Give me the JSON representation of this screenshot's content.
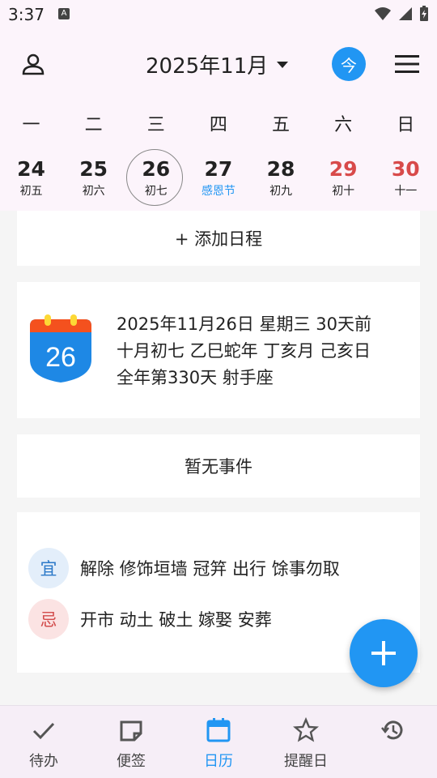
{
  "status": {
    "time": "3:37",
    "notification_badge": "A"
  },
  "header": {
    "title": "2025年11月",
    "today_label": "今"
  },
  "weekdays": [
    "一",
    "二",
    "三",
    "四",
    "五",
    "六",
    "日"
  ],
  "dates": [
    {
      "day": "24",
      "lunar": "初五"
    },
    {
      "day": "25",
      "lunar": "初六"
    },
    {
      "day": "26",
      "lunar": "初七"
    },
    {
      "day": "27",
      "lunar": "感恩节"
    },
    {
      "day": "28",
      "lunar": "初九"
    },
    {
      "day": "29",
      "lunar": "初十"
    },
    {
      "day": "30",
      "lunar": "十一"
    }
  ],
  "add_schedule_label": "+ 添加日程",
  "date_info": {
    "icon_day": "26",
    "line1": "2025年11月26日 星期三 30天前",
    "line2": "十月初七 乙巳蛇年 丁亥月 己亥日",
    "line3": "全年第330天 射手座"
  },
  "no_event_label": "暂无事件",
  "yiji": {
    "yi_label": "宜",
    "yi_text": "解除 修饰垣墙 冠笄 出行 馀事勿取",
    "ji_label": "忌",
    "ji_text": "开市 动土 破土 嫁娶 安葬"
  },
  "nav": [
    {
      "label": "待办",
      "icon": "check-icon"
    },
    {
      "label": "便签",
      "icon": "note-icon"
    },
    {
      "label": "日历",
      "icon": "calendar-icon"
    },
    {
      "label": "提醒日",
      "icon": "star-icon"
    },
    {
      "label": "",
      "icon": "history-icon"
    }
  ],
  "colors": {
    "accent": "#2196f3",
    "weekend": "#d84a4a",
    "festival": "#2196f3"
  }
}
